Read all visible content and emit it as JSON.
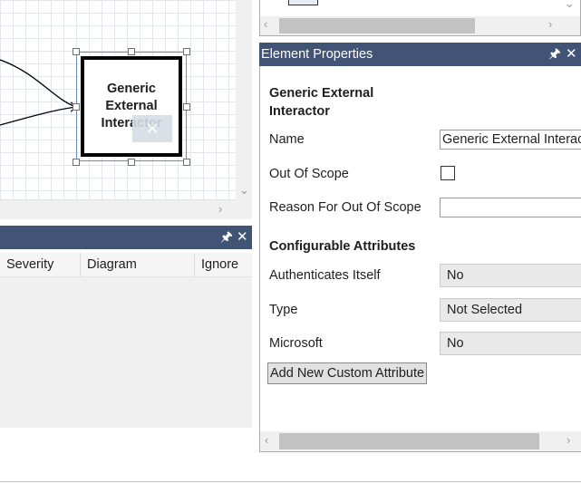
{
  "canvas": {
    "element_label": "Generic External Interactor"
  },
  "error_list": {
    "columns": [
      "Severity",
      "Diagram",
      "Ignore"
    ]
  },
  "properties": {
    "title": "Element Properties",
    "element_type": "Generic External Interactor",
    "name_label": "Name",
    "name_value": "Generic External Interactor",
    "out_of_scope_label": "Out Of Scope",
    "out_of_scope_checked": false,
    "reason_label": "Reason For Out Of Scope",
    "reason_value": "",
    "configurable_header": "Configurable Attributes",
    "attributes": [
      {
        "label": "Authenticates Itself",
        "value": "No"
      },
      {
        "label": "Type",
        "value": "Not Selected"
      },
      {
        "label": "Microsoft",
        "value": "No"
      }
    ],
    "add_button": "Add New Custom Attribute"
  },
  "icons": {
    "pin": "pin-icon",
    "close": "close-icon",
    "scroll_left": "chevron-left-icon",
    "scroll_right": "chevron-right-icon",
    "scroll_down": "chevron-down-icon"
  },
  "colors": {
    "panel_title_bg": "#425476",
    "grid_line": "#e3e6ec"
  }
}
